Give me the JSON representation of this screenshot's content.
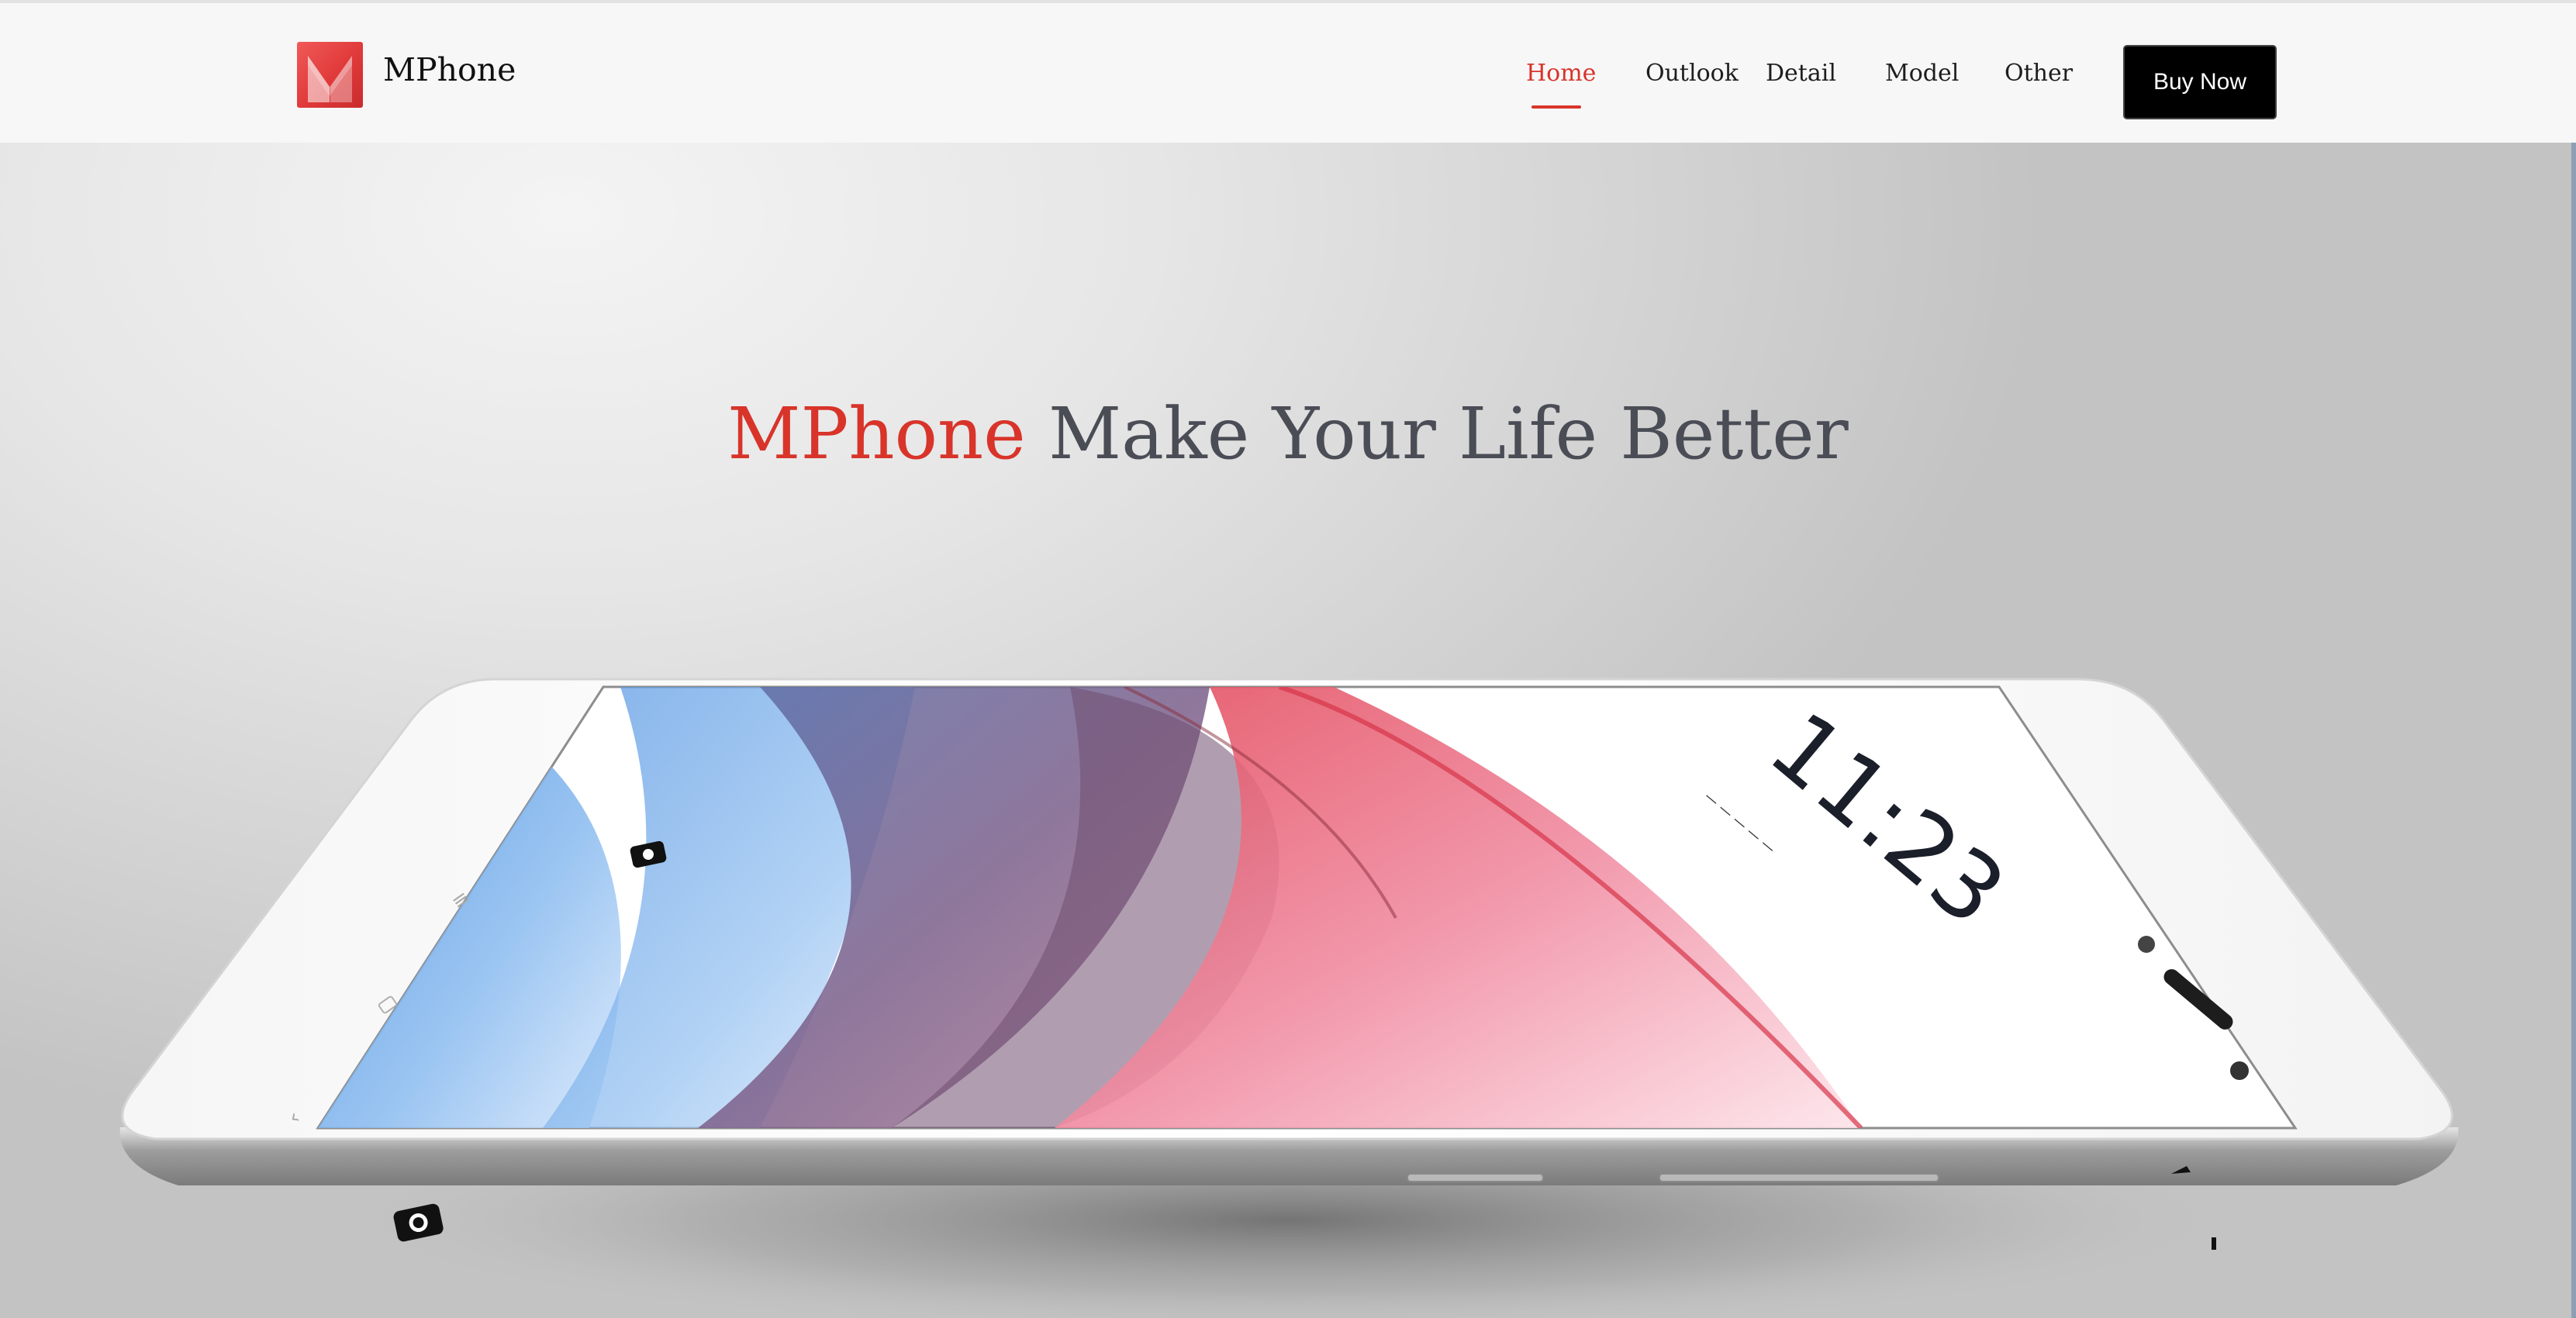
{
  "header": {
    "brand": "MPhone",
    "nav": [
      {
        "label": "Home",
        "active": true
      },
      {
        "label": "Outlook",
        "active": false
      },
      {
        "label": "Detail",
        "active": false
      },
      {
        "label": "Model",
        "active": false
      },
      {
        "label": "Other",
        "active": false
      }
    ],
    "buy_button": "Buy Now"
  },
  "hero": {
    "headline_accent": "MPhone",
    "headline_rest": " Make Your Life Better",
    "phone_clock": "11:23"
  },
  "colors": {
    "accent": "#d8342a",
    "headline_text": "#4a4d55",
    "button_bg": "#000000",
    "header_bg": "#f7f7f7"
  },
  "icons": {
    "logo": "m-logo-icon",
    "camera": "camera-icon"
  }
}
